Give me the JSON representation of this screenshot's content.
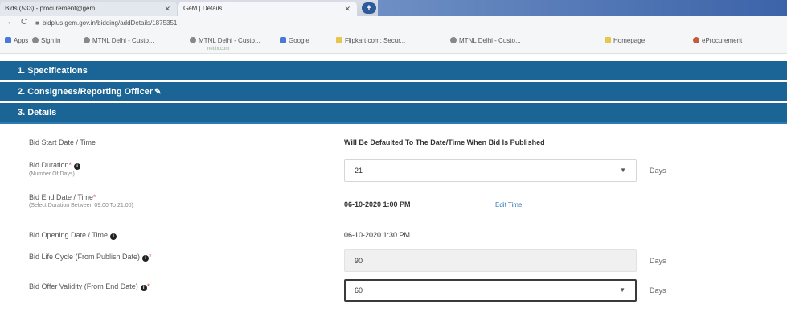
{
  "browser": {
    "tabs": [
      {
        "label": "Bids (533) - procurement@gem...",
        "close": "✕"
      },
      {
        "label": "GeM | Details",
        "close": "✕"
      }
    ],
    "new_tab": "+",
    "nav": {
      "back": "←",
      "reload": "C"
    },
    "url": "bidplus.gem.gov.in/bidding/addDetails/1875351",
    "bookmarks": [
      {
        "label": "Apps",
        "icon": "apps-icon"
      },
      {
        "label": "Sign in",
        "icon": "globe-icon"
      },
      {
        "label": "MTNL Delhi - Custo...",
        "icon": "globe-icon"
      },
      {
        "label": "MTNL Delhi - Custo...",
        "icon": "globe-icon"
      },
      {
        "label": "Google",
        "icon": "google-icon"
      },
      {
        "label": "Flipkart.com: Secur...",
        "icon": "folder-icon"
      },
      {
        "label": "MTNL Delhi - Custo...",
        "icon": "globe-icon"
      },
      {
        "label": "Homepage",
        "icon": "globe-icon"
      },
      {
        "label": "eProcurement",
        "icon": "flag-icon"
      }
    ],
    "bookmark_sub": "netfix.com"
  },
  "sections": {
    "specifications": "1. Specifications",
    "consignees": "2. Consignees/Reporting Officer",
    "details": "3. Details"
  },
  "form": {
    "bid_start": {
      "label": "Bid Start Date / Time",
      "value": "Will Be Defaulted To The Date/Time When Bid Is Published"
    },
    "bid_duration": {
      "label": "Bid Duration",
      "sublabel": "(Number Of Days)",
      "value": "21",
      "unit": "Days"
    },
    "bid_end": {
      "label": "Bid End Date / Time",
      "sublabel": "(Select Duration Between 09:00 To 21:00)",
      "value": "06-10-2020 1:00 PM",
      "link": "Edit Time"
    },
    "bid_opening": {
      "label": "Bid Opening Date / Time",
      "value": "06-10-2020 1:30 PM"
    },
    "bid_life_cycle": {
      "label": "Bid Life Cycle (From Publish Date)",
      "value": "90",
      "unit": "Days"
    },
    "bid_offer_validity": {
      "label": "Bid Offer Validity (From End Date)",
      "value": "60",
      "unit": "Days"
    }
  },
  "colors": {
    "section_bg": "#1a6496",
    "link": "#337ab7",
    "required": "#d9534f"
  }
}
